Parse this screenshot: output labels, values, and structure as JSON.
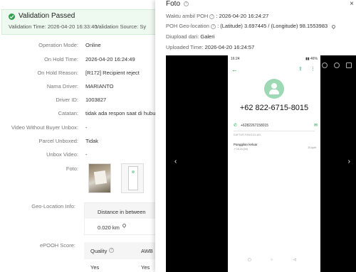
{
  "banner": {
    "title": "Validation Passed",
    "validation_time": "Validation Time: 2026-04-20 16:33:40",
    "validation_source": "Validation Source: Sy"
  },
  "details": [
    {
      "label": "Operation Mode:",
      "value": "Online"
    },
    {
      "label": "On Hold Time:",
      "value": "2026-04-20 16:24:49"
    },
    {
      "label": "On Hold Reason:",
      "value": "[R172] Recipient reject"
    },
    {
      "label": "Nama Driver:",
      "value": "MARIANTO"
    },
    {
      "label": "Driver ID:",
      "value": "1003827"
    },
    {
      "label": "Catatan:",
      "value": "tidak ada respon saat di hubun"
    },
    {
      "label": "Video Without Buyer Unbox:",
      "value": "-"
    },
    {
      "label": "Parcel Unboxed:",
      "value": "Tidak"
    },
    {
      "label": "Unbox Video:",
      "value": "-"
    },
    {
      "label": "Foto:",
      "value": ""
    }
  ],
  "geo": {
    "label": "Geo-Location Info:",
    "column_header": "Distance in between",
    "distance": "0.020 km"
  },
  "epooh": {
    "label": "ePOOH Score:",
    "col_quality": "Quality",
    "col_awb": "AWB",
    "quality_value": "Yes",
    "awb_value": "Yes"
  },
  "foto_panel": {
    "title": "Foto",
    "close": "×",
    "waktu_label": "Waktu ambil POH",
    "waktu_value": ": 2026-04-20 16:24:27",
    "geo_label": "POH Geo-location",
    "geo_value": ": (Latitude) 3.697445 / (Longitude) 98.1553983",
    "diupload_label": "Diupload dari:",
    "diupload_value": "Galeri",
    "uploaded_label": "Uploaded Time:",
    "uploaded_value": "2026-04-20 16:24:57",
    "prev": "‹",
    "next": "›"
  },
  "phone": {
    "status_time": "16:24",
    "status_right": "▮▮ 46%",
    "number": "+62 822-6715-8015",
    "call_number": "+6282267158015",
    "section_label": "DAFTAR PANGGILAN",
    "call_type": "Panggilan keluar",
    "call_time": "↗ 16.24 (0d)",
    "call_date": "20 April"
  },
  "colors": {
    "success": "#30a14e",
    "accent_green": "#17a34a",
    "avatar": "#9ed9b6"
  }
}
